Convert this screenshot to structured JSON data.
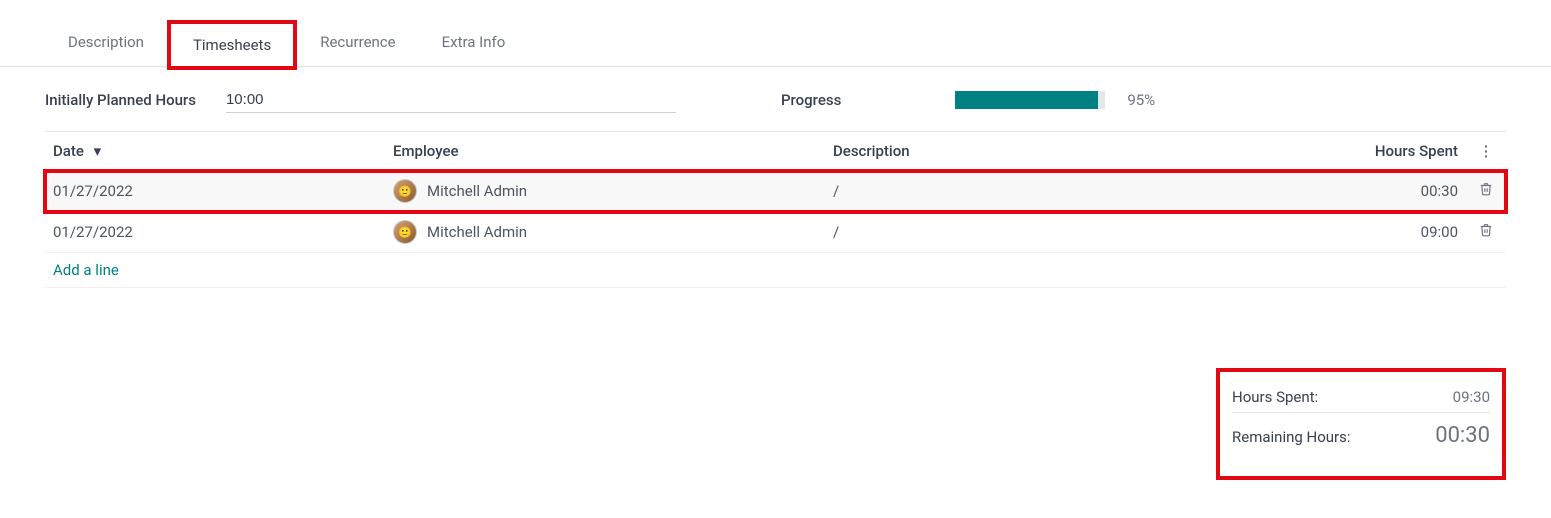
{
  "tabs": {
    "description": "Description",
    "timesheets": "Timesheets",
    "recurrence": "Recurrence",
    "extra_info": "Extra Info"
  },
  "planned": {
    "label": "Initially Planned Hours",
    "value": "10:00"
  },
  "progress": {
    "label": "Progress",
    "percent_text": "95%"
  },
  "cols": {
    "date": "Date",
    "employee": "Employee",
    "description": "Description",
    "hours": "Hours Spent"
  },
  "rows": [
    {
      "date": "01/27/2022",
      "employee": "Mitchell Admin",
      "description": "/",
      "hours": "00:30"
    },
    {
      "date": "01/27/2022",
      "employee": "Mitchell Admin",
      "description": "/",
      "hours": "09:00"
    }
  ],
  "add_line": "Add a line",
  "totals": {
    "spent_label": "Hours Spent:",
    "spent_value": "09:30",
    "remaining_label": "Remaining Hours:",
    "remaining_value": "00:30"
  }
}
